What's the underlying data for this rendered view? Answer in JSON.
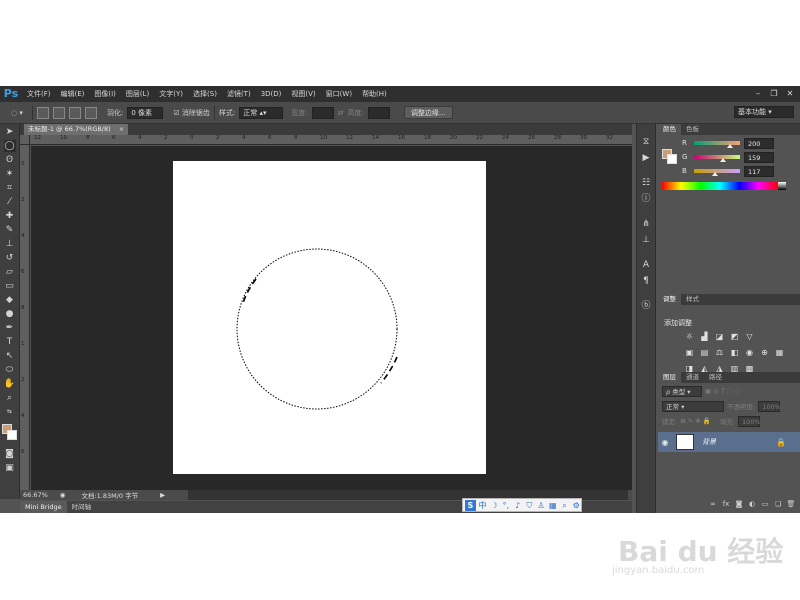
{
  "app": {
    "logo": "Ps"
  },
  "menu": [
    "文件(F)",
    "编辑(E)",
    "图像(I)",
    "图层(L)",
    "文字(Y)",
    "选择(S)",
    "滤镜(T)",
    "3D(D)",
    "视图(V)",
    "窗口(W)",
    "帮助(H)"
  ],
  "options": {
    "feather_label": "羽化:",
    "feather_value": "0 像素",
    "antialias_label": "消除锯齿",
    "style_label": "样式:",
    "style_value": "正常",
    "width_label": "宽度:",
    "height_label": "高度:",
    "refine_edge": "调整边缘...",
    "workspace": "基本功能"
  },
  "document": {
    "tab_title": "未标题-1 @ 66.7%(RGB/8)",
    "ruler_h": [
      "12",
      "10",
      "8",
      "6",
      "4",
      "2",
      "0",
      "2",
      "4",
      "6",
      "8",
      "10",
      "12",
      "14",
      "16",
      "18",
      "20",
      "22",
      "24",
      "26",
      "28",
      "30",
      "32"
    ],
    "ruler_v": [
      "0",
      "2",
      "4",
      "6",
      "8",
      "1",
      "2",
      "4",
      "6"
    ],
    "canvas_color": "#ffffff",
    "pasteboard_color": "#282828"
  },
  "status": {
    "zoom": "66.67%",
    "doc_info": "文档:1.83M/0 字节"
  },
  "bottom_tabs": [
    "Mini Bridge",
    "时间轴"
  ],
  "colors": {
    "foreground": "#c89f75",
    "tabs": [
      "颜色",
      "色板"
    ],
    "r": "200",
    "g": "159",
    "b": "117",
    "labels": [
      "R",
      "G",
      "B"
    ]
  },
  "adjustments": {
    "tabs": [
      "调整",
      "样式"
    ],
    "title": "添加调整"
  },
  "layers": {
    "tabs": [
      "图层",
      "通道",
      "路径"
    ],
    "kind_label": "ρ 类型",
    "blend_mode": "正常",
    "opacity_label": "不透明度:",
    "opacity_value": "100%",
    "lock_label": "锁定:",
    "fill_label": "填充:",
    "fill_value": "100%",
    "background_name": "背景"
  },
  "watermark": {
    "text": "Bai du 经验",
    "url": "jingyan.baidu.com"
  }
}
